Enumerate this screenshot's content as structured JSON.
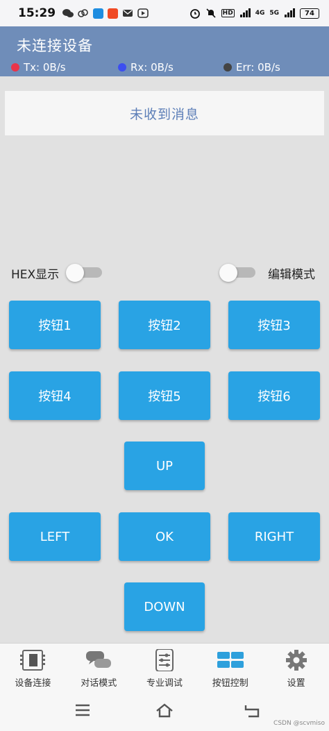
{
  "status_bar": {
    "time": "15:29",
    "network_label": "4G",
    "net_5g": "5G",
    "hd_label": "HD",
    "battery": "74",
    "left_icons": [
      "wechat-icon",
      "cloud-icon",
      "app-blue-icon",
      "app-orange-icon",
      "mail-icon",
      "play-icon"
    ]
  },
  "header": {
    "title": "未连接设备",
    "tx": "Tx: 0B/s",
    "rx": "Rx: 0B/s",
    "err": "Err: 0B/s",
    "colors": {
      "tx": "#e8344a",
      "rx": "#3c4ef0",
      "err": "#444444",
      "bar": "#6f8db9"
    }
  },
  "message_panel": {
    "text": "未收到消息"
  },
  "switches": {
    "hex": {
      "label": "HEX显示",
      "on": false
    },
    "edit": {
      "label": "编辑模式",
      "on": false
    }
  },
  "buttons": {
    "b1": "按钮1",
    "b2": "按钮2",
    "b3": "按钮3",
    "b4": "按钮4",
    "b5": "按钮5",
    "b6": "按钮6",
    "up": "UP",
    "left": "LEFT",
    "ok": "OK",
    "right": "RIGHT",
    "down": "DOWN",
    "color": "#29a3e4"
  },
  "bottom_nav": [
    {
      "label": "设备连接",
      "icon": "device-icon",
      "active": false
    },
    {
      "label": "对话模式",
      "icon": "chat-icon",
      "active": false
    },
    {
      "label": "专业调试",
      "icon": "debug-icon",
      "active": false
    },
    {
      "label": "按钮控制",
      "icon": "grid-icon",
      "active": true
    },
    {
      "label": "设置",
      "icon": "gear-icon",
      "active": false
    }
  ],
  "watermark": "CSDN @scvmiso"
}
